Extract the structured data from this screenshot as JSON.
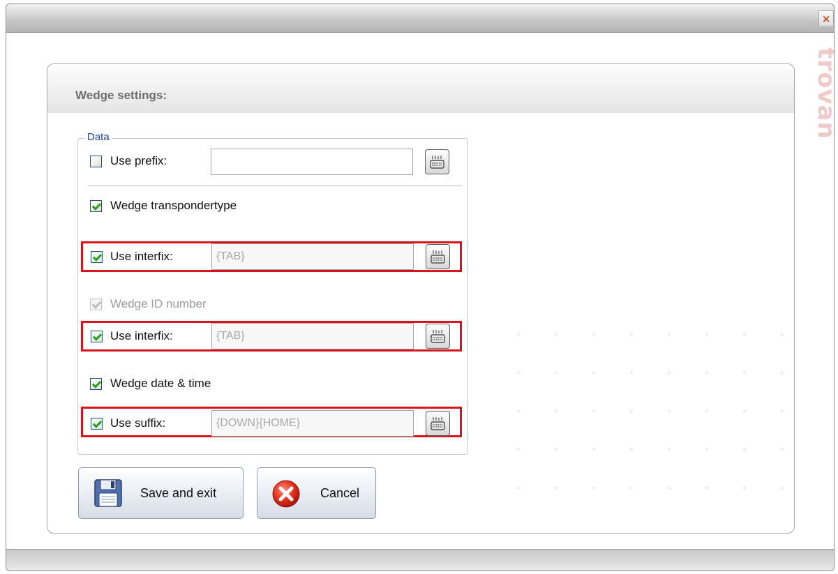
{
  "window": {
    "close_glyph": "×",
    "brand_text": "trovan"
  },
  "panel": {
    "title": "Wedge settings:"
  },
  "data_group": {
    "legend": "Data",
    "prefix": {
      "label": "Use prefix:",
      "checked": false,
      "value": ""
    },
    "transponder_type": {
      "label": "Wedge transpondertype",
      "checked": true
    },
    "interfix_1": {
      "label": "Use interfix:",
      "checked": true,
      "value": "{TAB}"
    },
    "id_number": {
      "label": "Wedge ID number",
      "checked": true,
      "disabled": true
    },
    "interfix_2": {
      "label": "Use interfix:",
      "checked": true,
      "value": "{TAB}"
    },
    "date_time": {
      "label": "Wedge date & time",
      "checked": true
    },
    "suffix": {
      "label": "Use suffix:",
      "checked": true,
      "value": "{DOWN}{HOME}"
    }
  },
  "buttons": {
    "save_label": "Save and exit",
    "cancel_label": "Cancel"
  },
  "icons": [
    "keyboard-icon",
    "floppy-disk-icon",
    "cancel-icon",
    "close-icon"
  ],
  "colors": {
    "highlight_border": "#d9121c",
    "legend": "#1c3f95",
    "check": "#21a121",
    "brand": "#f0c9cb"
  }
}
